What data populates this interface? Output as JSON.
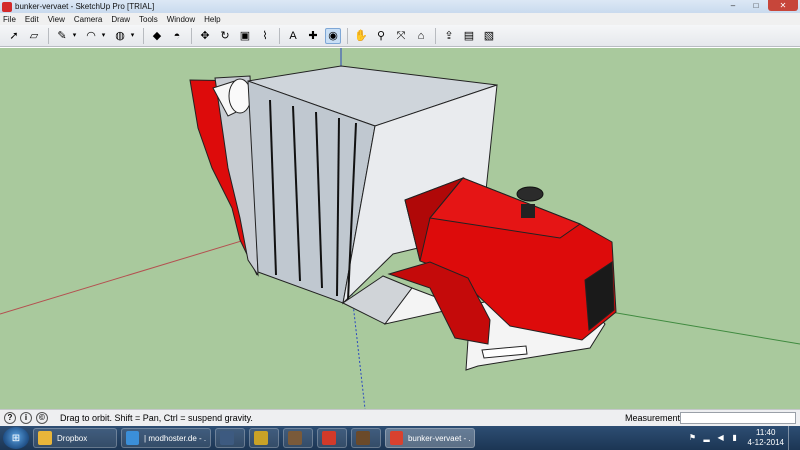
{
  "window": {
    "title": "bunker-vervaet - SketchUp Pro [TRIAL]",
    "minimize": "–",
    "maximize": "□",
    "close": "✕"
  },
  "menu": [
    "File",
    "Edit",
    "View",
    "Camera",
    "Draw",
    "Tools",
    "Window",
    "Help"
  ],
  "toolbar": {
    "tools": [
      {
        "icon": "select-arrow-icon",
        "glyph": "➚"
      },
      {
        "icon": "eraser-icon",
        "glyph": "▱"
      },
      {
        "icon": "pencil-icon",
        "glyph": "✎"
      },
      {
        "icon": "arc-icon",
        "glyph": "◠"
      },
      {
        "icon": "paint-bucket-icon",
        "glyph": "◍"
      },
      {
        "icon": "push-pull-icon",
        "glyph": "◆"
      },
      {
        "icon": "follow-me-icon",
        "glyph": "◓"
      },
      {
        "icon": "move-icon",
        "glyph": "✥"
      },
      {
        "icon": "rotate-icon",
        "glyph": "↻"
      },
      {
        "icon": "offset-icon",
        "glyph": "▣"
      },
      {
        "icon": "tape-measure-icon",
        "glyph": "⌇"
      },
      {
        "icon": "text-icon",
        "glyph": "A"
      },
      {
        "icon": "axes-icon",
        "glyph": "✚"
      },
      {
        "icon": "orbit-icon",
        "glyph": "◉"
      },
      {
        "icon": "pan-icon",
        "glyph": "✋"
      },
      {
        "icon": "zoom-icon",
        "glyph": "⚲"
      },
      {
        "icon": "zoom-extents-icon",
        "glyph": "⤧"
      },
      {
        "icon": "warehouse-icon",
        "glyph": "⌂"
      },
      {
        "icon": "share-model-icon",
        "glyph": "⇪"
      },
      {
        "icon": "extension-warehouse-icon",
        "glyph": "▤"
      },
      {
        "icon": "send-to-layout-icon",
        "glyph": "▧"
      }
    ],
    "active_tool": "orbit-icon"
  },
  "status": {
    "hint": "Drag to orbit.  Shift = Pan, Ctrl = suspend gravity.",
    "measurements_label": "Measurements",
    "measurements_value": ""
  },
  "taskbar": {
    "items": [
      {
        "name": "taskbar-folder",
        "icon": "folder-icon",
        "label": "Dropbox",
        "color": "#e8b53a"
      },
      {
        "name": "taskbar-chrome",
        "icon": "chrome-icon",
        "label": "| modhoster.de - ...",
        "color": "#3b8fd9"
      },
      {
        "name": "taskbar-app-x",
        "icon": "app-icon",
        "label": "",
        "color": "#3d5a80"
      },
      {
        "name": "taskbar-key",
        "icon": "key-icon",
        "label": "",
        "color": "#c9a227"
      },
      {
        "name": "taskbar-game-1",
        "icon": "game-icon",
        "label": "",
        "color": "#7a5a3a"
      },
      {
        "name": "taskbar-opera",
        "icon": "opera-icon",
        "label": "",
        "color": "#d23a2a"
      },
      {
        "name": "taskbar-game-2",
        "icon": "game-icon",
        "label": "",
        "color": "#6b4a2a"
      },
      {
        "name": "taskbar-sketchup",
        "icon": "sketchup-icon",
        "label": "bunker-vervaet - ...",
        "color": "#d9412f"
      }
    ],
    "time": "11:40",
    "date": "4-12-2014"
  },
  "colors": {
    "viewport_bg": "#a9c99d",
    "model_red": "#dd0b0b",
    "model_grey": "#c7ccd2",
    "model_white": "#f4f4f4"
  }
}
